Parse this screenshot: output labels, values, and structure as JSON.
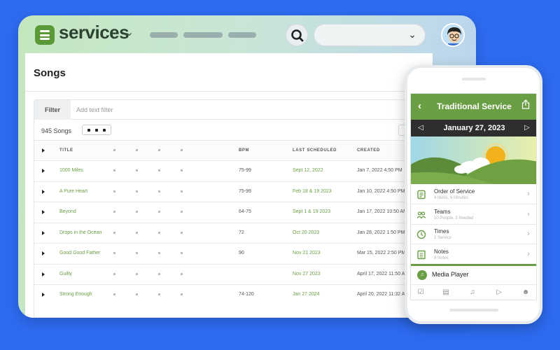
{
  "app": {
    "name": "services"
  },
  "page": {
    "title": "Songs"
  },
  "filter": {
    "label": "Filter",
    "placeholder": "Add text filter"
  },
  "song_count": "945 Songs",
  "table": {
    "headers": {
      "title": "TITLE",
      "bpm": "BPM",
      "last": "LAST SCHEDULED",
      "created": "CREATED"
    },
    "rows": [
      {
        "title": "1000 Miles",
        "bpm": "75-99",
        "last": "Sept 12, 2022",
        "created": "Jan 7, 2022 4:50 PM"
      },
      {
        "title": "A Pure Heart",
        "bpm": "75-99",
        "last": "Feb 18 & 19 2023",
        "created": "Jan 10, 2022 4:50 PM"
      },
      {
        "title": "Beyond",
        "bpm": "64-75",
        "last": "Sept 1 & 19 2023",
        "created": "Jan 17, 2022 10:50 AM"
      },
      {
        "title": "Drops in the Ocean",
        "bpm": "72",
        "last": "Oct 20 2023",
        "created": "Jan 28, 2022 1:50 PM"
      },
      {
        "title": "Good Good Father",
        "bpm": "90",
        "last": "Nov 21 2023",
        "created": "Mar 15, 2022 2:50 PM"
      },
      {
        "title": "Guilty",
        "bpm": "",
        "last": "Nov 27 2023",
        "created": "April 17, 2022 11:50 AM"
      },
      {
        "title": "Strong Enough",
        "bpm": "74-120",
        "last": "Jan 27 2024",
        "created": "April 20, 2022 11:32 AM"
      }
    ]
  },
  "phone": {
    "service_title": "Traditional Service",
    "date": "January 27, 2023",
    "items": [
      {
        "title": "Order of Service",
        "subtitle": "4 Items, 9 Minutes",
        "icon": "order-icon"
      },
      {
        "title": "Teams",
        "subtitle": "10 People, 3 Needed",
        "icon": "teams-icon"
      },
      {
        "title": "Times",
        "subtitle": "1 Service",
        "icon": "clock-icon"
      },
      {
        "title": "Notes",
        "subtitle": "8 Notes",
        "icon": "notes-icon"
      }
    ],
    "media_player": "Media Player"
  },
  "colors": {
    "brand_green": "#6a9e44",
    "background_blue": "#2d6bf0",
    "date_bar": "#2e2e2e"
  }
}
